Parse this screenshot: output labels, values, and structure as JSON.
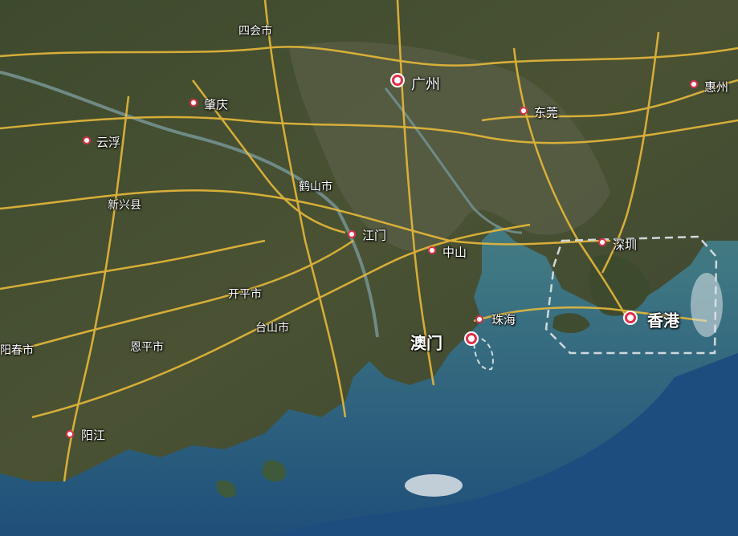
{
  "places": [
    {
      "id": "sihui",
      "label": "四会市",
      "dot": false
    },
    {
      "id": "guangzhou",
      "label": "广州",
      "dot": true
    },
    {
      "id": "zhaoqing",
      "label": "肇庆",
      "dot": true
    },
    {
      "id": "huizhou",
      "label": "惠州",
      "dot": true
    },
    {
      "id": "dongguan",
      "label": "东莞",
      "dot": true
    },
    {
      "id": "yunfu",
      "label": "云浮",
      "dot": true
    },
    {
      "id": "heshan",
      "label": "鹤山市",
      "dot": false
    },
    {
      "id": "xinxing",
      "label": "新兴县",
      "dot": false
    },
    {
      "id": "jiangmen",
      "label": "江门",
      "dot": true
    },
    {
      "id": "zhongshan",
      "label": "中山",
      "dot": true
    },
    {
      "id": "shenzhen",
      "label": "深圳",
      "dot": true
    },
    {
      "id": "kaiping",
      "label": "开平市",
      "dot": false
    },
    {
      "id": "zhuhai",
      "label": "珠海",
      "dot": true
    },
    {
      "id": "hongkong",
      "label": "香港",
      "dot": true
    },
    {
      "id": "taishan",
      "label": "台山市",
      "dot": false
    },
    {
      "id": "macau",
      "label": "澳门",
      "dot": true
    },
    {
      "id": "yangchun",
      "label": "阳春市",
      "dot": false
    },
    {
      "id": "enping",
      "label": "恩平市",
      "dot": false
    },
    {
      "id": "yangjiang",
      "label": "阳江",
      "dot": true
    }
  ]
}
